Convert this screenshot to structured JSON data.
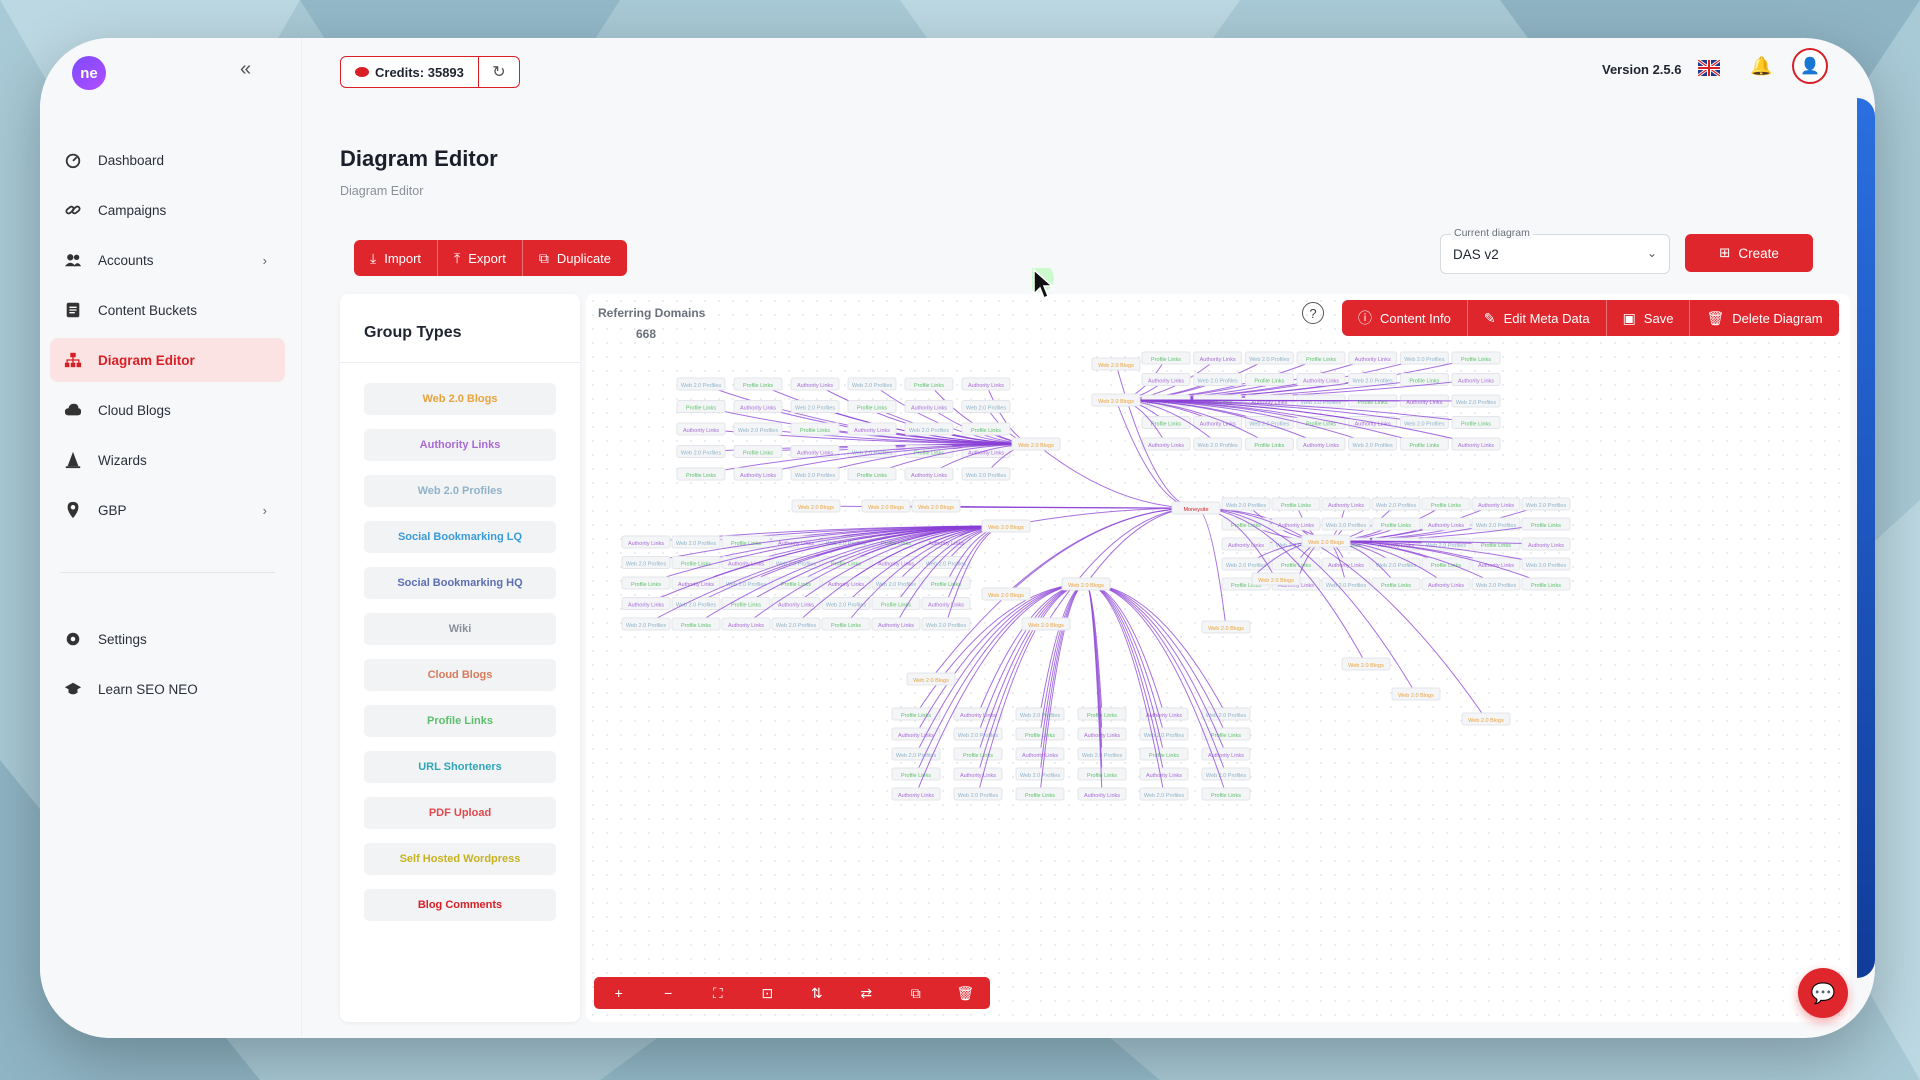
{
  "app": {
    "logo_text": "ne",
    "version": "Version 2.5.6"
  },
  "credits": {
    "label": "Credits: 35893"
  },
  "sidebar": {
    "items": [
      {
        "label": "Dashboard",
        "icon": "dashboard-icon"
      },
      {
        "label": "Campaigns",
        "icon": "link-icon"
      },
      {
        "label": "Accounts",
        "icon": "users-icon",
        "has_children": true
      },
      {
        "label": "Content Buckets",
        "icon": "document-icon"
      },
      {
        "label": "Diagram Editor",
        "icon": "sitemap-icon",
        "active": true
      },
      {
        "label": "Cloud Blogs",
        "icon": "cloud-icon"
      },
      {
        "label": "Wizards",
        "icon": "wizard-icon"
      },
      {
        "label": "GBP",
        "icon": "map-pin-icon",
        "has_children": true
      }
    ],
    "bottom_items": [
      {
        "label": "Settings",
        "icon": "gear-icon"
      },
      {
        "label": "Learn SEO NEO",
        "icon": "graduation-cap-icon"
      }
    ]
  },
  "page": {
    "title": "Diagram Editor",
    "breadcrumb": "Diagram Editor"
  },
  "toolbar": {
    "import": "Import",
    "export": "Export",
    "duplicate": "Duplicate"
  },
  "current_diagram": {
    "label": "Current diagram",
    "value": "DAS v2"
  },
  "create": "Create",
  "group_types": {
    "title": "Group Types",
    "items": [
      {
        "label": "Web 2.0 Blogs",
        "color": "#e8a33c"
      },
      {
        "label": "Authority Links",
        "color": "#a86bd6"
      },
      {
        "label": "Web 2.0 Profiles",
        "color": "#8fb3c9"
      },
      {
        "label": "Social Bookmarking LQ",
        "color": "#3a9bd9"
      },
      {
        "label": "Social Bookmarking HQ",
        "color": "#5b6fb3"
      },
      {
        "label": "Wiki",
        "color": "#8a8f99"
      },
      {
        "label": "Cloud Blogs",
        "color": "#d87a5a"
      },
      {
        "label": "Profile Links",
        "color": "#5cc06a"
      },
      {
        "label": "URL Shorteners",
        "color": "#2fa6b8"
      },
      {
        "label": "PDF Upload",
        "color": "#e0484d"
      },
      {
        "label": "Self Hosted Wordpress",
        "color": "#c7b21f"
      },
      {
        "label": "Blog Comments",
        "color": "#d81f26"
      }
    ]
  },
  "canvas": {
    "referring_domains_label": "Referring Domains",
    "referring_domains_value": "668",
    "actions": {
      "content_info": "Content Info",
      "edit_meta": "Edit Meta Data",
      "save": "Save",
      "delete": "Delete Diagram"
    },
    "center_node": "Moneysite",
    "hub_label": "Web 2.0 Blogs",
    "leaf_labels": [
      "Web 2.0 Profiles",
      "Profile Links",
      "Authority Links"
    ]
  },
  "zoom_controls": [
    "+",
    "−",
    "⛶",
    "⊡",
    "⇅",
    "⇄",
    "⧉",
    "🗑"
  ],
  "colors": {
    "accent": "#e0262d",
    "edge": "#8a3fd6"
  }
}
